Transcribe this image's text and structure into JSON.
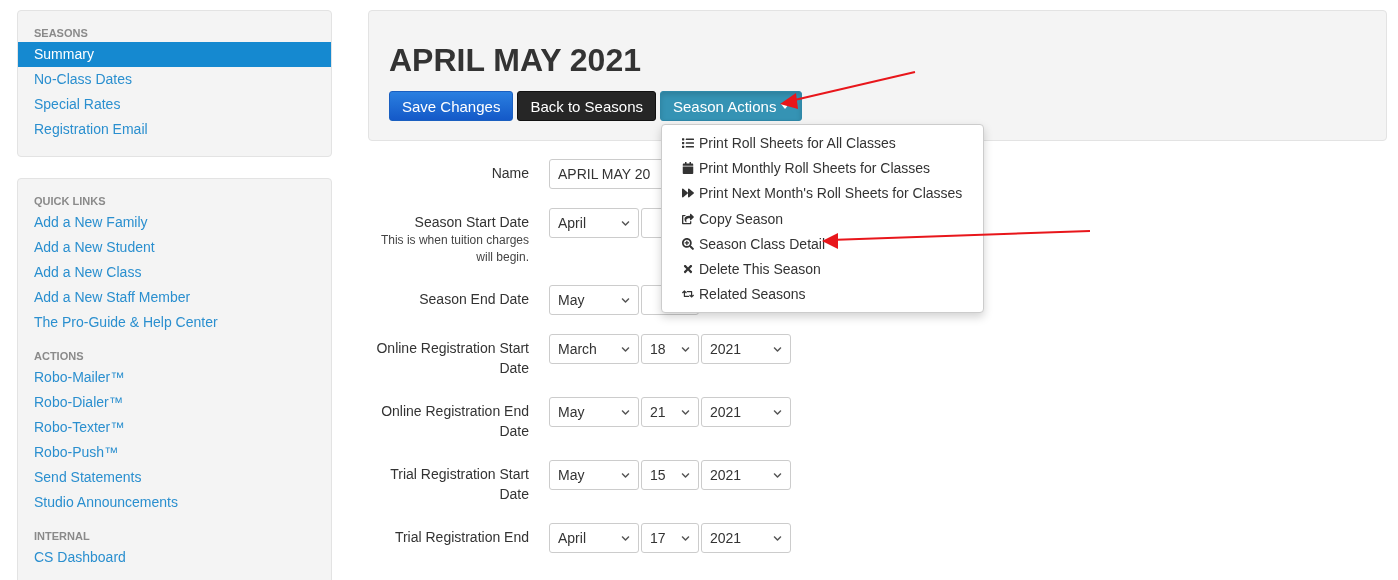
{
  "sidebar": {
    "panels": [
      {
        "sections": [
          {
            "heading": "SEASONS",
            "items": [
              {
                "label": "Summary",
                "selected": true
              },
              {
                "label": "No-Class Dates",
                "selected": false
              },
              {
                "label": "Special Rates",
                "selected": false
              },
              {
                "label": "Registration Email",
                "selected": false
              }
            ]
          }
        ]
      },
      {
        "sections": [
          {
            "heading": "QUICK LINKS",
            "items": [
              {
                "label": "Add a New Family",
                "selected": false
              },
              {
                "label": "Add a New Student",
                "selected": false
              },
              {
                "label": "Add a New Class",
                "selected": false
              },
              {
                "label": "Add a New Staff Member",
                "selected": false
              },
              {
                "label": "The Pro-Guide & Help Center",
                "selected": false
              }
            ]
          },
          {
            "heading": "ACTIONS",
            "items": [
              {
                "label": "Robo-Mailer™",
                "selected": false
              },
              {
                "label": "Robo-Dialer™",
                "selected": false
              },
              {
                "label": "Robo-Texter™",
                "selected": false
              },
              {
                "label": "Robo-Push™",
                "selected": false
              },
              {
                "label": "Send Statements",
                "selected": false
              },
              {
                "label": "Studio Announcements",
                "selected": false
              }
            ]
          },
          {
            "heading": "INTERNAL",
            "items": [
              {
                "label": "CS Dashboard",
                "selected": false
              }
            ]
          }
        ]
      }
    ]
  },
  "header": {
    "title": "APRIL MAY 2021",
    "buttons": [
      {
        "label": "Save Changes",
        "kind": "primary"
      },
      {
        "label": "Back to Seasons",
        "kind": "dark"
      },
      {
        "label": "Season Actions",
        "kind": "menu",
        "expanded": true
      }
    ],
    "menu": [
      "Print Roll Sheets for All Classes",
      "Print Monthly Roll Sheets for Classes",
      "Print Next Month's Roll Sheets for Classes",
      "Copy Season",
      "Season Class Detail",
      "Delete This Season",
      "Related Seasons"
    ]
  },
  "form": {
    "fields": [
      {
        "label": "Name",
        "kind": "text",
        "value": "APRIL MAY 20"
      },
      {
        "label": "Season Start Date",
        "note": "This is when tuition charges will begin.",
        "kind": "date",
        "selects": [
          "April"
        ]
      },
      {
        "label": "Season End Date",
        "kind": "date",
        "selects": [
          "May"
        ]
      },
      {
        "label": "Online Registration Start Date",
        "kind": "date",
        "selects": [
          "March",
          "18",
          "2021"
        ]
      },
      {
        "label": "Online Registration End Date",
        "kind": "date",
        "selects": [
          "May",
          "21",
          "2021"
        ]
      },
      {
        "label": "Trial Registration Start Date",
        "kind": "date",
        "selects": [
          "May",
          "15",
          "2021"
        ]
      },
      {
        "label": "Trial Registration End",
        "kind": "date",
        "selects": [
          "April",
          "17",
          "2021"
        ]
      }
    ]
  }
}
